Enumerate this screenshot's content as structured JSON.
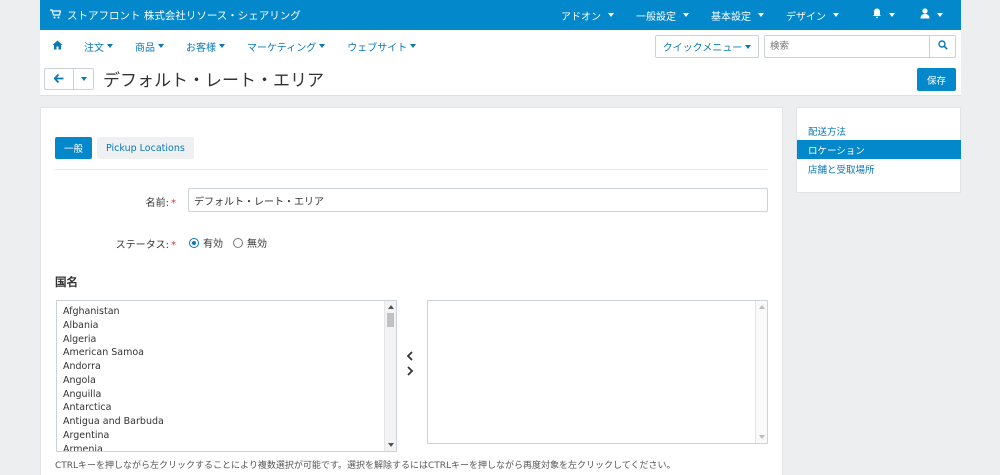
{
  "topbar": {
    "store_label": "ストアフロント 株式会社リソース・シェアリング",
    "menus": [
      "アドオン",
      "一般設定",
      "基本設定",
      "デザイン"
    ]
  },
  "nav": {
    "items": [
      "注文",
      "商品",
      "お客様",
      "マーケティング",
      "ウェブサイト"
    ],
    "quick_menu": "クイックメニュー",
    "search_placeholder": "検索"
  },
  "page": {
    "title": "デフォルト・レート・エリア",
    "save_label": "保存"
  },
  "tabs": [
    "一般",
    "Pickup Locations"
  ],
  "form": {
    "name_label": "名前:",
    "name_value": "デフォルト・レート・エリア",
    "status_label": "ステータス:",
    "status_options": [
      "有効",
      "無効"
    ],
    "status_selected": "有効",
    "countries_heading": "国名",
    "countries": [
      "Afghanistan",
      "Albania",
      "Algeria",
      "American Samoa",
      "Andorra",
      "Angola",
      "Anguilla",
      "Antarctica",
      "Antigua and Barbuda",
      "Argentina",
      "Armenia"
    ],
    "hint": "CTRLキーを押しながら左クリックすることにより複数選択が可能です。選択を解除するにはCTRLキーを押しながら再度対象を左クリックしてください。"
  },
  "sidebar": {
    "items": [
      "配送方法",
      "ロケーション",
      "店舗と受取場所"
    ],
    "active": "ロケーション"
  }
}
